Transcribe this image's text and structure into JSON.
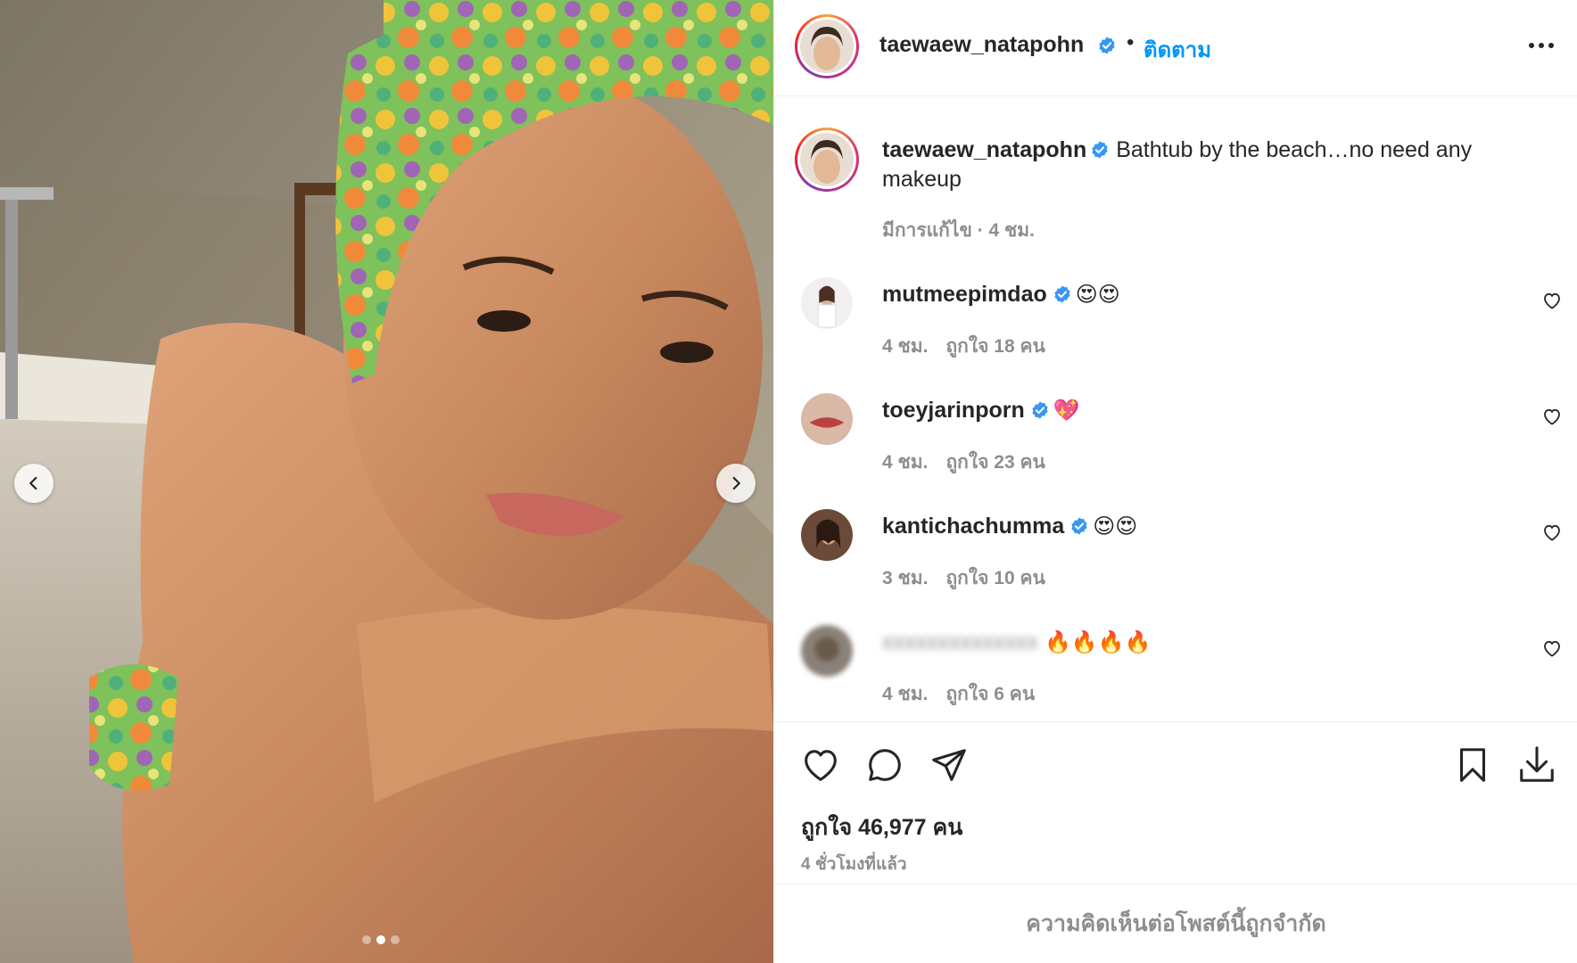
{
  "post": {
    "username": "taewaew_natapohn",
    "follow_label": "ติดตาม",
    "separator": "•",
    "caption_text": "Bathtub by the beach…no need any makeup",
    "caption_meta": "มีการแก้ไข · 4 ชม.",
    "likes": "ถูกใจ 46,977 คน",
    "time_ago": "4 ชั่วโมงที่แล้ว",
    "comments_limited": "ความคิดเห็นต่อโพสต์นี้ถูกจำกัด"
  },
  "comments": [
    {
      "username": "mutmeepimdao",
      "text": "😍😍",
      "time": "4 ชม.",
      "likes": "ถูกใจ 18 คน"
    },
    {
      "username": "toeyjarinporn",
      "text": "💖",
      "time": "4 ชม.",
      "likes": "ถูกใจ 23 คน"
    },
    {
      "username": "kantichachumma",
      "text": "😍😍",
      "time": "3 ชม.",
      "likes": "ถูกใจ 10 คน"
    },
    {
      "username": "blurred",
      "text": "🔥🔥🔥🔥",
      "time": "4 ชม.",
      "likes": "ถูกใจ 6 คน"
    }
  ],
  "carousel": {
    "count": 3,
    "active_index": 1
  },
  "icons": {
    "verified": "verified-badge-icon",
    "more": "more-options-icon",
    "like": "heart-icon",
    "comment": "comment-bubble-icon",
    "share": "paper-plane-icon",
    "save": "bookmark-icon",
    "download": "download-icon"
  },
  "colors": {
    "link": "#0095f6",
    "verified": "#3897f0",
    "secondary_text": "#8e8e8e",
    "primary_text": "#262626"
  }
}
